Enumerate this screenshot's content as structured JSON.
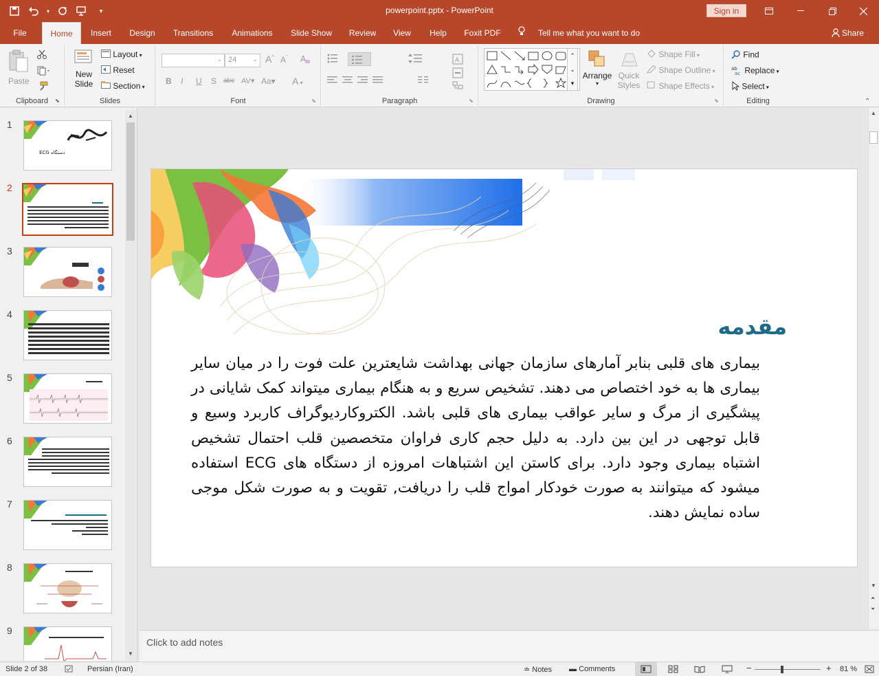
{
  "titlebar": {
    "title": "powerpoint.pptx  -  PowerPoint",
    "signin": "Sign in"
  },
  "tabs": [
    {
      "label": "File"
    },
    {
      "label": "Home"
    },
    {
      "label": "Insert"
    },
    {
      "label": "Design"
    },
    {
      "label": "Transitions"
    },
    {
      "label": "Animations"
    },
    {
      "label": "Slide Show"
    },
    {
      "label": "Review"
    },
    {
      "label": "View"
    },
    {
      "label": "Help"
    },
    {
      "label": "Foxit PDF"
    },
    {
      "label": "Tell me what you want to do"
    }
  ],
  "share": "Share",
  "ribbon": {
    "clipboard": {
      "label": "Clipboard",
      "paste": "Paste"
    },
    "slides": {
      "label": "Slides",
      "new_slide_1": "New",
      "new_slide_2": "Slide",
      "layout": "Layout",
      "reset": "Reset",
      "section": "Section"
    },
    "font": {
      "label": "Font",
      "font_name": "",
      "font_size": "24"
    },
    "paragraph": {
      "label": "Paragraph"
    },
    "drawing": {
      "label": "Drawing",
      "arrange": "Arrange",
      "quick_styles_1": "Quick",
      "quick_styles_2": "Styles",
      "shape_fill": "Shape Fill",
      "shape_outline": "Shape Outline",
      "shape_effects": "Shape Effects"
    },
    "editing": {
      "label": "Editing",
      "find": "Find",
      "replace": "Replace",
      "select": "Select"
    }
  },
  "slides_panel": {
    "numbers": [
      "1",
      "2",
      "3",
      "4",
      "5",
      "6",
      "7",
      "8",
      "9"
    ],
    "selected": 2,
    "thumb1_caption": "دستگاه ECG"
  },
  "slide": {
    "heading": "مقدمه",
    "body": "بیماری های قلبی بنابر آمارهای سازمان جهانی بهداشت شایعترین علت فوت را در میان سایر بیماری ها به خود اختصاص می دهند. تشخیص سریع و به هنگام بیماری میتواند کمک شایانی در پیشگیری از مرگ و سایر عواقب بیماری های قلبی باشد. الکتروکاردیوگراف کاربرد وسیع و قابل توجهی در این بین دارد. به دلیل حجم کاری فراوان متخصصین قلب احتمال تشخیص اشتباه بیماری وجود دارد. برای کاستن این اشتباهات امروزه از دستگاه های ECG استفاده میشود که میتوانند به صورت خودکار امواج قلب را دریافت, تقویت و به صورت شکل موجی ساده نمایش دهند."
  },
  "notes_placeholder": "Click to add notes",
  "status": {
    "slide_of": "Slide 2 of 38",
    "language": "Persian (Iran)",
    "notes": "Notes",
    "comments": "Comments",
    "zoom": "81 %"
  },
  "colors": {
    "accent": "#b7472a",
    "heading": "#1d6b86"
  }
}
